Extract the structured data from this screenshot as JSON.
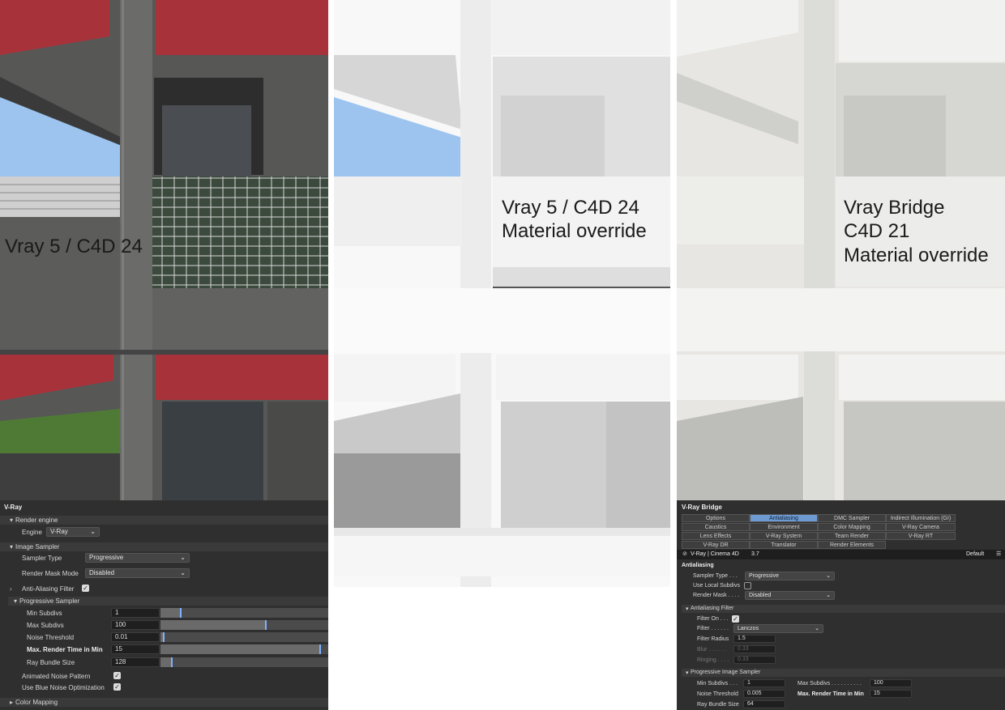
{
  "renders": {
    "left_label": "Vray 5 / C4D 24",
    "middle_label_line1": "Vray 5 / C4D 24",
    "middle_label_line2": "Material override",
    "right_label_line1": "Vray Bridge",
    "right_label_line2": "C4D 21",
    "right_label_line3": "Material override"
  },
  "vray_panel": {
    "title": "V-Ray",
    "render_engine_section": "Render engine",
    "engine_label": "Engine",
    "engine_value": "V-Ray",
    "image_sampler_section": "Image Sampler",
    "sampler_type_label": "Sampler Type",
    "sampler_type_value": "Progressive",
    "render_mask_label": "Render Mask Mode",
    "render_mask_value": "Disabled",
    "aa_filter_label": "Anti-Aliasing Filter",
    "progressive_section": "Progressive Sampler",
    "min_subdivs_label": "Min Subdivs",
    "min_subdivs_value": "1",
    "max_subdivs_label": "Max Subdivs",
    "max_subdivs_value": "100",
    "noise_threshold_label": "Noise Threshold",
    "noise_threshold_value": "0.01",
    "max_render_time_label": "Max. Render Time in Min",
    "max_render_time_value": "15",
    "ray_bundle_label": "Ray Bundle Size",
    "ray_bundle_value": "128",
    "animated_noise_label": "Animated Noise Pattern",
    "blue_noise_label": "Use Blue Noise Optimization",
    "color_mapping_section": "Color Mapping",
    "sliders": {
      "min_subdivs": 0.12,
      "max_subdivs": 0.63,
      "noise_threshold": 0.02,
      "max_render_time": 0.95,
      "ray_bundle": 0.07
    }
  },
  "bridge_panel": {
    "title": "V-Ray Bridge",
    "tabs_row1": [
      "Options",
      "Antialiasing",
      "DMC Sampler",
      "Indirect Illumination (GI)"
    ],
    "tabs_row2": [
      "Caustics",
      "Environment",
      "Color Mapping",
      "V-Ray Camera"
    ],
    "tabs_row3": [
      "Lens Effects",
      "V-Ray System",
      "Team Render",
      "V-Ray RT"
    ],
    "tabs_row4": [
      "V-Ray DR",
      "Translator",
      "Render Elements"
    ],
    "active_tab": "Antialiasing",
    "version_label": "V-Ray | Cinema 4D",
    "version_value": "3.7",
    "preset_value": "Default",
    "section_title": "Antialiasing",
    "sampler_type_label": "Sampler Type . . .",
    "sampler_type_value": "Progressive",
    "use_local_subdivs_label": "Use Local Subdivs",
    "render_mask_label": "Render Mask . . . .",
    "render_mask_value": "Disabled",
    "aa_filter_section": "Antialiasing Filter",
    "filter_on_label": "Filter On . . .",
    "filter_label": "Filter . . . . . .",
    "filter_value": "Lanczos",
    "filter_radius_label": "Filter Radius",
    "filter_radius_value": "1.5",
    "blur_label": "Blur . . . . . .",
    "blur_value": "0.33",
    "ringing_label": "Ringing . . . .",
    "ringing_value": "0.33",
    "progressive_section": "Progressive Image Sampler",
    "min_subdivs_label": "Min Subdivs . . .",
    "min_subdivs_value": "1",
    "max_subdivs_label": "Max Subdivs . . . . . . . . . .",
    "max_subdivs_value": "100",
    "noise_threshold_label": "Noise Threshold",
    "noise_threshold_value": "0.005",
    "max_render_time_label": "Max. Render Time in Min",
    "max_render_time_value": "15",
    "ray_bundle_label": "Ray Bundle Size",
    "ray_bundle_value": "64"
  }
}
